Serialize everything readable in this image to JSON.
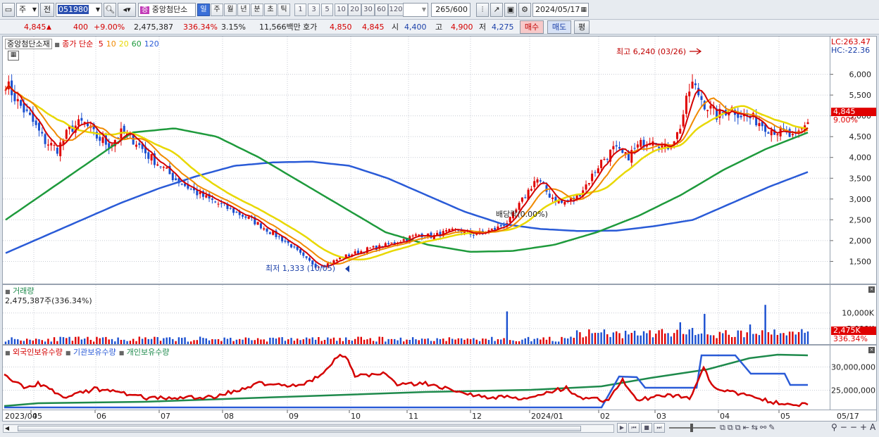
{
  "toolbar": {
    "market": "주",
    "prev_label": "전",
    "code": "051980",
    "name": "중앙첨단소",
    "periods": [
      "일",
      "주",
      "월",
      "년",
      "분",
      "초",
      "틱"
    ],
    "active_period": "일",
    "minute_units": [
      "1",
      "3",
      "5",
      "10",
      "20",
      "30",
      "60",
      "120"
    ],
    "count": "265",
    "count_max": "/600",
    "date": "2024/05/17"
  },
  "quote": {
    "price": "4,845",
    "change": "400",
    "change_pct": "+9.00%",
    "volume": "2,475,387",
    "volume_ratio": "336.34%",
    "turnover_pct": "3.15%",
    "amount": "11,566백만",
    "bid_label": "호가",
    "ask": "4,850",
    "bid": "4,845",
    "open_label": "시",
    "open": "4,400",
    "high_label": "고",
    "high": "4,900",
    "low_label": "저",
    "low": "4,275",
    "buy_label": "매수",
    "sell_label": "매도",
    "eval_label": "평"
  },
  "price_panel": {
    "stock_name": "중앙첨단소재",
    "ma_title": "종가 단순",
    "ma_periods": [
      "5",
      "10",
      "20",
      "60",
      "120"
    ],
    "ma_colors": [
      "#d40000",
      "#f08a00",
      "#e8d800",
      "#1e9a3c",
      "#2a5bd7"
    ],
    "lc": "LC:263.47",
    "hc": "HC:-22.36",
    "max_label": "최고 6,240 (03/26)",
    "min_label": "최저 1,333 (10/05)",
    "dividend_label": "배당락(0.00%)",
    "current_price_tag": "4,845",
    "current_pct_tag": "9.00%"
  },
  "volume_panel": {
    "title": "거래량",
    "info": "2,475,387주(336.34%)",
    "tag_value": "2,475K",
    "tag_pct": "336.34%"
  },
  "holding_panel": {
    "series_labels": [
      "외국인보유수량",
      "기관보유수량",
      "개인보유수량"
    ],
    "series_colors": [
      "#d40000",
      "#2a5bd7",
      "#1e8a4c"
    ]
  },
  "x_axis_labels": [
    "2023/04",
    "05",
    "06",
    "07",
    "08",
    "09",
    "10",
    "11",
    "12",
    "2024/01",
    "02",
    "03",
    "04",
    "05",
    "05/17"
  ],
  "chart_data": {
    "type": "line",
    "price": {
      "ylim": [
        1000,
        6500
      ],
      "y_ticks": [
        "6,000",
        "5,500",
        "5,000",
        "4,500",
        "4,000",
        "3,500",
        "3,000",
        "2,500",
        "2,000",
        "1,500"
      ],
      "close_approx": [
        5800,
        5300,
        4900,
        4400,
        4200,
        4700,
        4850,
        4500,
        4300,
        4600,
        4400,
        4050,
        3800,
        3500,
        3300,
        3100,
        2950,
        2800,
        2650,
        2500,
        2300,
        2100,
        1900,
        1600,
        1380,
        1450,
        1600,
        1700,
        1800,
        1850,
        1950,
        2050,
        2150,
        2100,
        2200,
        2250,
        2150,
        2200,
        2300,
        2500,
        3000,
        3500,
        3100,
        2900,
        3000,
        3400,
        3900,
        4200,
        4000,
        4300,
        4500,
        4200,
        4600,
        5800,
        5300,
        5000,
        5200,
        5000,
        4900,
        4700,
        4600,
        4445,
        4845
      ],
      "ma120_approx": [
        1700,
        2100,
        2500,
        2900,
        3250,
        3550,
        3800,
        3880,
        3900,
        3800,
        3500,
        3100,
        2700,
        2400,
        2280,
        2230,
        2240,
        2350,
        2500,
        2900,
        3300,
        3650
      ],
      "ma60_approx": [
        2500,
        3200,
        3900,
        4600,
        4700,
        4500,
        4000,
        3400,
        2800,
        2200,
        1900,
        1730,
        1750,
        1900,
        2200,
        2600,
        3100,
        3700,
        4200,
        4600
      ]
    },
    "volume": {
      "y_ticks": [
        "10,000K",
        "5,000K"
      ],
      "ylim": [
        0,
        14000
      ]
    },
    "holdings": {
      "y_ticks": [
        "30,000,000",
        "25,000,000"
      ],
      "ylim": [
        21000000,
        32500000
      ]
    }
  }
}
